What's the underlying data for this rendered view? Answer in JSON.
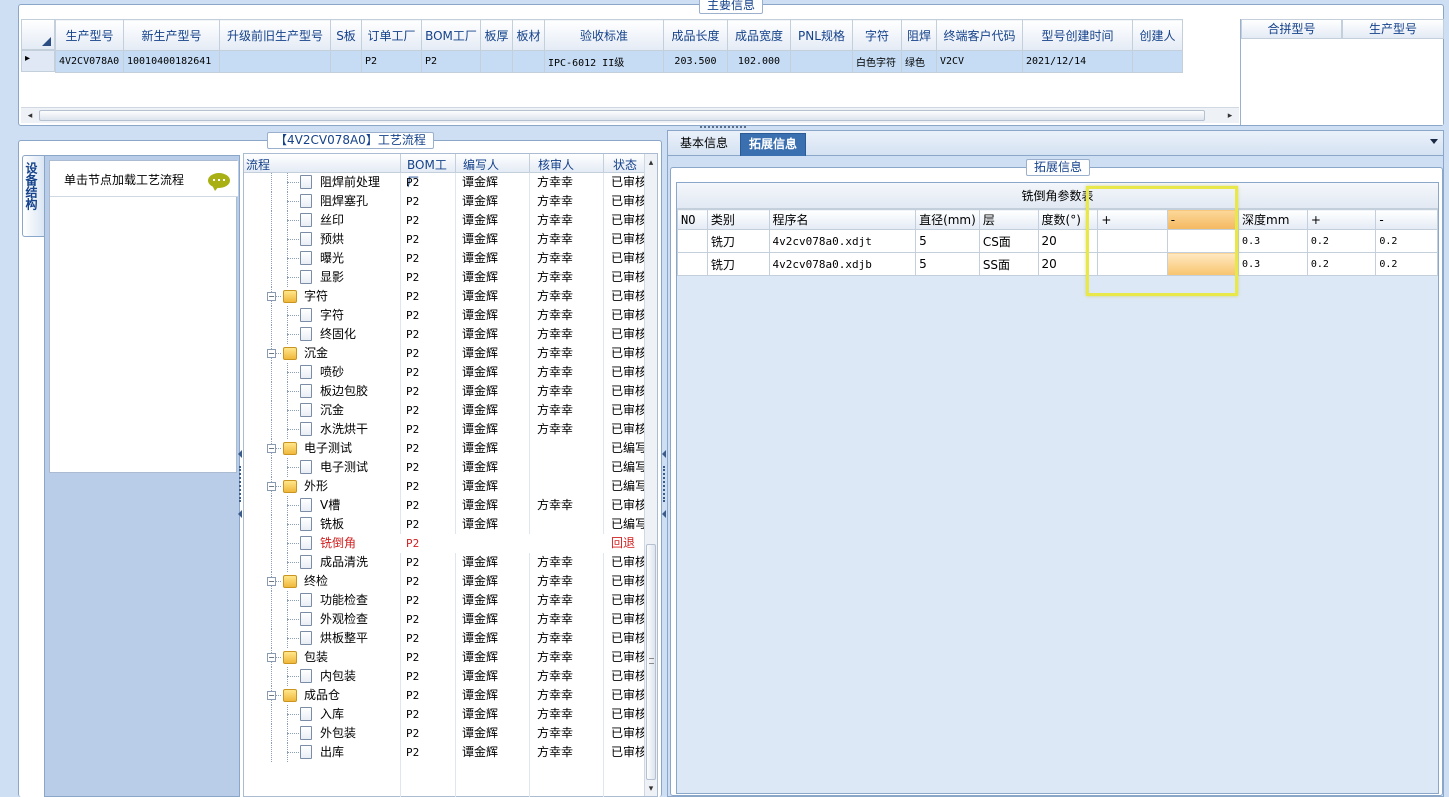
{
  "top_panel": {
    "title": "主要信息",
    "columns": [
      "生产型号",
      "新生产型号",
      "升级前旧生产型号",
      "S板",
      "订单工厂",
      "BOM工厂",
      "板厚",
      "板材",
      "验收标准",
      "成品长度",
      "成品宽度",
      "PNL规格",
      "字符",
      "阻焊",
      "终端客户代码",
      "型号创建时间",
      "创建人"
    ],
    "row": [
      "4V2CV078A0",
      "10010400182641",
      "",
      "",
      "P2",
      "P2",
      "",
      "",
      "IPC-6012 II级",
      "203.500",
      "102.000",
      "",
      "白色字符",
      "绿色",
      "V2CV",
      "2021/12/14",
      ""
    ],
    "right_columns": [
      "合拼型号",
      "生产型号"
    ],
    "row_indicator": "▸"
  },
  "left_tab": {
    "label": "设备结构"
  },
  "left_panel": {
    "hint": "单击节点加载工艺流程"
  },
  "flow_panel": {
    "title": "【4V2CV078A0】工艺流程",
    "columns": [
      "流程",
      "BOM工厂",
      "编写人",
      "核审人",
      "状态"
    ],
    "rows": [
      {
        "name": "阻焊前处理",
        "bom": "P2",
        "writer": "谭金辉",
        "reviewer": "方幸幸",
        "status": "已审核",
        "level": 2
      },
      {
        "name": "阻焊塞孔",
        "bom": "P2",
        "writer": "谭金辉",
        "reviewer": "方幸幸",
        "status": "已审核",
        "level": 2
      },
      {
        "name": "丝印",
        "bom": "P2",
        "writer": "谭金辉",
        "reviewer": "方幸幸",
        "status": "已审核",
        "level": 2
      },
      {
        "name": "预烘",
        "bom": "P2",
        "writer": "谭金辉",
        "reviewer": "方幸幸",
        "status": "已审核",
        "level": 2
      },
      {
        "name": "曝光",
        "bom": "P2",
        "writer": "谭金辉",
        "reviewer": "方幸幸",
        "status": "已审核",
        "level": 2
      },
      {
        "name": "显影",
        "bom": "P2",
        "writer": "谭金辉",
        "reviewer": "方幸幸",
        "status": "已审核",
        "level": 2
      },
      {
        "name": "字符",
        "bom": "P2",
        "writer": "谭金辉",
        "reviewer": "方幸幸",
        "status": "已审核",
        "level": 1
      },
      {
        "name": "字符",
        "bom": "P2",
        "writer": "谭金辉",
        "reviewer": "方幸幸",
        "status": "已审核",
        "level": 2
      },
      {
        "name": "终固化",
        "bom": "P2",
        "writer": "谭金辉",
        "reviewer": "方幸幸",
        "status": "已审核",
        "level": 2
      },
      {
        "name": "沉金",
        "bom": "P2",
        "writer": "谭金辉",
        "reviewer": "方幸幸",
        "status": "已审核",
        "level": 1
      },
      {
        "name": "喷砂",
        "bom": "P2",
        "writer": "谭金辉",
        "reviewer": "方幸幸",
        "status": "已审核",
        "level": 2
      },
      {
        "name": "板边包胶",
        "bom": "P2",
        "writer": "谭金辉",
        "reviewer": "方幸幸",
        "status": "已审核",
        "level": 2
      },
      {
        "name": "沉金",
        "bom": "P2",
        "writer": "谭金辉",
        "reviewer": "方幸幸",
        "status": "已审核",
        "level": 2
      },
      {
        "name": "水洗烘干",
        "bom": "P2",
        "writer": "谭金辉",
        "reviewer": "方幸幸",
        "status": "已审核",
        "level": 2
      },
      {
        "name": "电子测试",
        "bom": "P2",
        "writer": "谭金辉",
        "reviewer": "",
        "status": "已编写",
        "level": 1
      },
      {
        "name": "电子测试",
        "bom": "P2",
        "writer": "谭金辉",
        "reviewer": "",
        "status": "已编写",
        "level": 2
      },
      {
        "name": "外形",
        "bom": "P2",
        "writer": "谭金辉",
        "reviewer": "",
        "status": "已编写",
        "level": 1
      },
      {
        "name": "V槽",
        "bom": "P2",
        "writer": "谭金辉",
        "reviewer": "方幸幸",
        "status": "已审核",
        "level": 2
      },
      {
        "name": "铣板",
        "bom": "P2",
        "writer": "谭金辉",
        "reviewer": "",
        "status": "已编写",
        "level": 2
      },
      {
        "name": "铣倒角",
        "bom": "P2",
        "writer": "",
        "reviewer": "",
        "status": "回退",
        "level": 2,
        "highlight": true
      },
      {
        "name": "成品清洗",
        "bom": "P2",
        "writer": "谭金辉",
        "reviewer": "方幸幸",
        "status": "已审核",
        "level": 2
      },
      {
        "name": "终检",
        "bom": "P2",
        "writer": "谭金辉",
        "reviewer": "方幸幸",
        "status": "已审核",
        "level": 1
      },
      {
        "name": "功能检查",
        "bom": "P2",
        "writer": "谭金辉",
        "reviewer": "方幸幸",
        "status": "已审核",
        "level": 2
      },
      {
        "name": "外观检查",
        "bom": "P2",
        "writer": "谭金辉",
        "reviewer": "方幸幸",
        "status": "已审核",
        "level": 2
      },
      {
        "name": "烘板整平",
        "bom": "P2",
        "writer": "谭金辉",
        "reviewer": "方幸幸",
        "status": "已审核",
        "level": 2
      },
      {
        "name": "包装",
        "bom": "P2",
        "writer": "谭金辉",
        "reviewer": "方幸幸",
        "status": "已审核",
        "level": 1
      },
      {
        "name": "内包装",
        "bom": "P2",
        "writer": "谭金辉",
        "reviewer": "方幸幸",
        "status": "已审核",
        "level": 2
      },
      {
        "name": "成品仓",
        "bom": "P2",
        "writer": "谭金辉",
        "reviewer": "方幸幸",
        "status": "已审核",
        "level": 1
      },
      {
        "name": "入库",
        "bom": "P2",
        "writer": "谭金辉",
        "reviewer": "方幸幸",
        "status": "已审核",
        "level": 2
      },
      {
        "name": "外包装",
        "bom": "P2",
        "writer": "谭金辉",
        "reviewer": "方幸幸",
        "status": "已审核",
        "level": 2
      },
      {
        "name": "出库",
        "bom": "P2",
        "writer": "谭金辉",
        "reviewer": "方幸幸",
        "status": "已审核",
        "level": 2
      }
    ]
  },
  "right_panel": {
    "tabs": [
      "基本信息",
      "拓展信息"
    ],
    "active_tab": "拓展信息",
    "group_title": "拓展信息",
    "table_title": "铣倒角参数表",
    "columns": [
      "NO",
      "类别",
      "程序名",
      "直径(mm)",
      "层",
      "度数(°)",
      "+",
      "-",
      "深度mm",
      "+",
      "-"
    ],
    "rows": [
      [
        "",
        "铣刀",
        "4v2cv078a0.xdjt",
        "5",
        "CS面",
        "20",
        "",
        "",
        "0.3",
        "0.2",
        "0.2"
      ],
      [
        "",
        "铣刀",
        "4v2cv078a0.xdjb",
        "5",
        "SS面",
        "20",
        "",
        "",
        "0.3",
        "0.2",
        "0.2"
      ]
    ]
  },
  "colors": {
    "accent": "#15428b",
    "selected_row": "#c5dcf4",
    "highlight_box": "#e8e84a",
    "rollback": "#d02020",
    "orange_header": "#f4b860"
  }
}
